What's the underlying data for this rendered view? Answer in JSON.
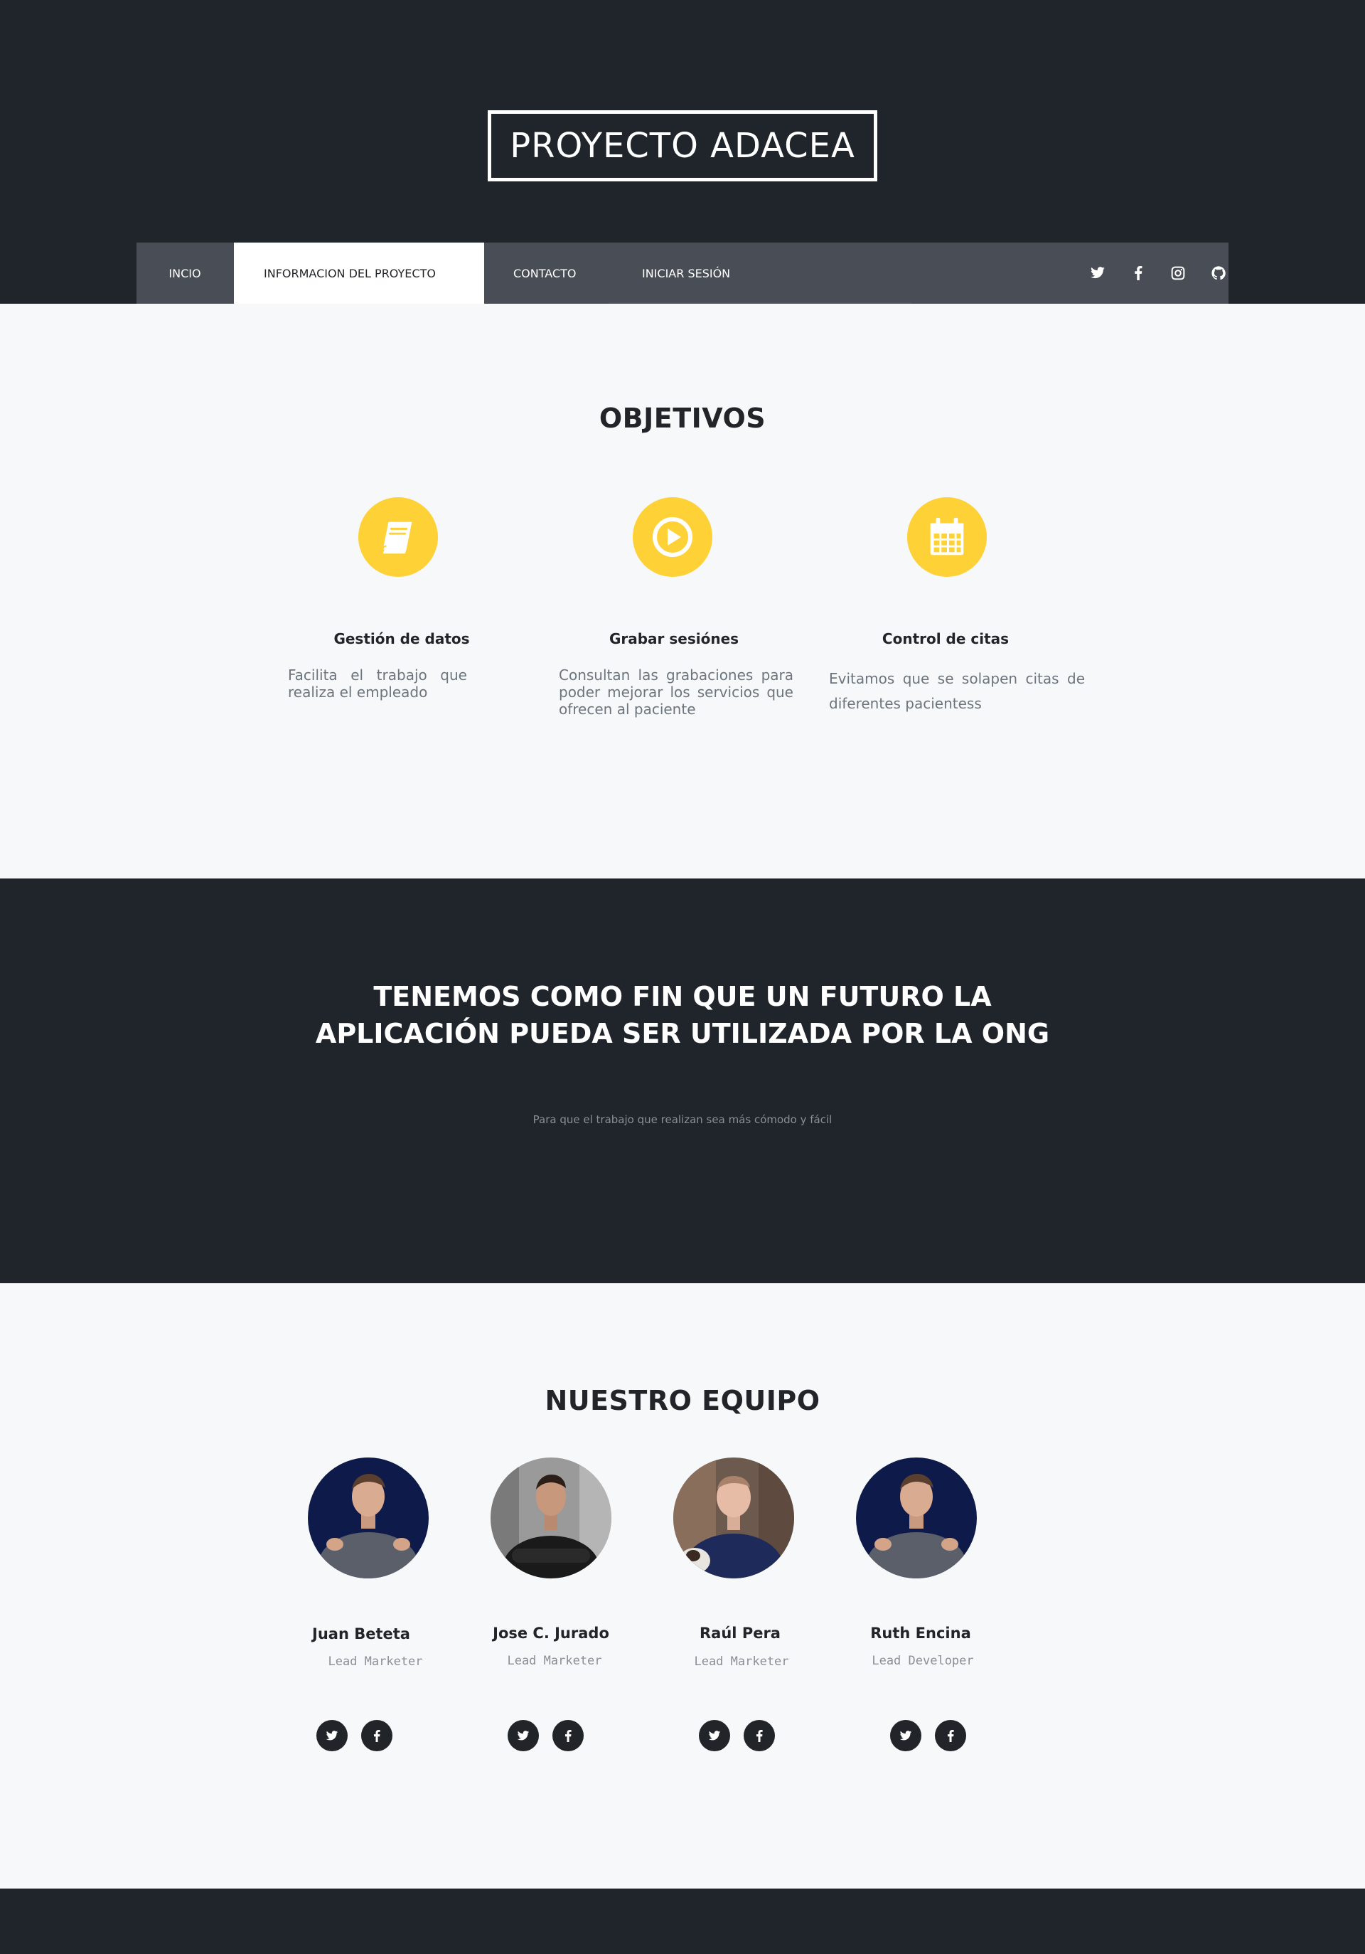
{
  "header": {
    "brand": "PROYECTO ADACEA",
    "nav": [
      {
        "label": "INCIO"
      },
      {
        "label": "INFORMACION DEL PROYECTO",
        "active": true
      },
      {
        "label": "CONTACTO"
      },
      {
        "label": "INICIAR SESIÓN"
      }
    ],
    "social_icons": [
      "twitter-icon",
      "facebook-icon",
      "instagram-icon",
      "github-icon"
    ]
  },
  "objetivos": {
    "title": "OBJETIVOS",
    "items": [
      {
        "icon": "book-icon",
        "title": "Gestión de datos",
        "text": "Facilita el trabajo que realiza el empleado"
      },
      {
        "icon": "play-circle-icon",
        "title": "Grabar sesiónes",
        "text": "Consultan las grabaciones para poder mejorar los servicios que ofrecen al paciente"
      },
      {
        "icon": "calendar-icon",
        "title": "Control de citas",
        "text": "Evitamos que se solapen citas de diferentes pacientess"
      }
    ]
  },
  "mission": {
    "title": "TENEMOS COMO FIN QUE UN FUTURO LA APLICACIÓN PUEDA SER UTILIZADA POR LA ONG",
    "subtitle": "Para que el trabajo que realizan sea más cómodo y fácil"
  },
  "team": {
    "title": "NUESTRO EQUIPO",
    "members": [
      {
        "name": "Juan Beteta",
        "role": "Lead Marketer"
      },
      {
        "name": "Jose C. Jurado",
        "role": "Lead Marketer"
      },
      {
        "name": "Raúl Pera",
        "role": "Lead Marketer"
      },
      {
        "name": "Ruth Encina",
        "role": "Lead Developer"
      }
    ]
  },
  "colors": {
    "dark": "#20242b",
    "navbar": "#494d55",
    "accent": "#fed136",
    "light_bg": "#f7f8fa"
  }
}
